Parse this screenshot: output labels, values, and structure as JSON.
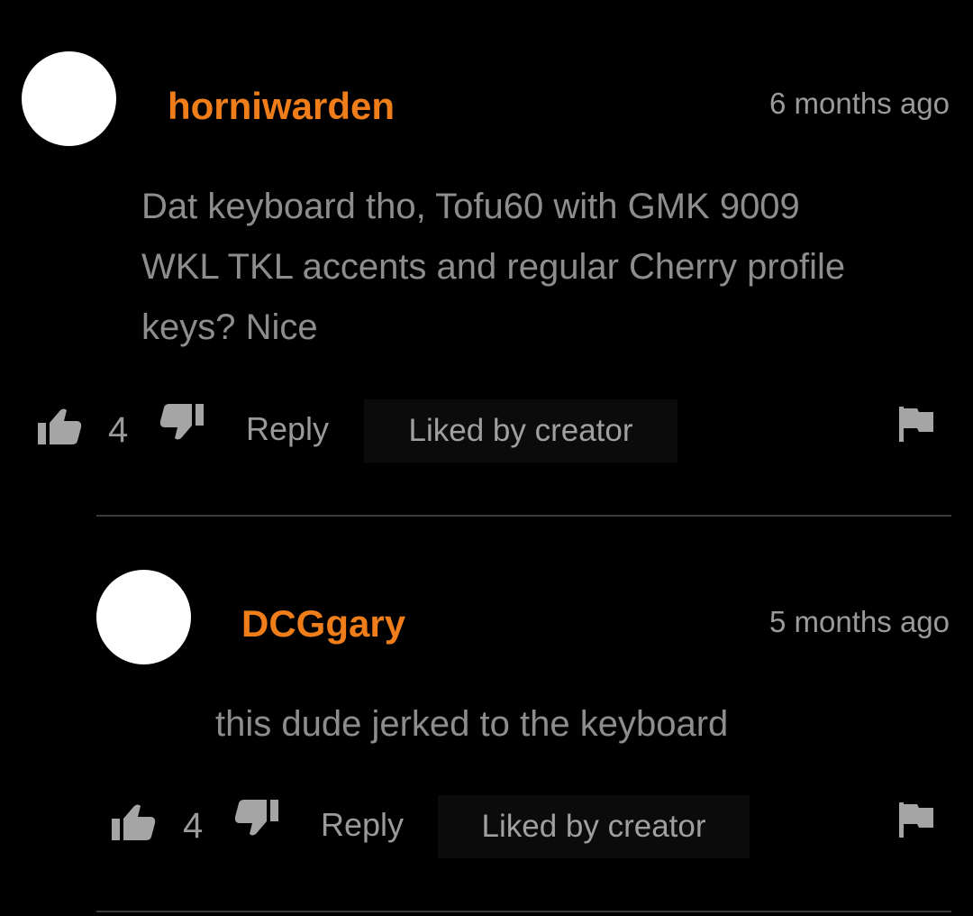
{
  "comments": [
    {
      "username": "horniwarden",
      "timestamp": "6 months ago",
      "lines": [
        "Dat keyboard tho, Tofu60 with GMK 9009",
        "WKL TKL accents and regular Cherry profile",
        "keys? Nice"
      ],
      "likes": "4",
      "reply_label": "Reply",
      "liked_label": "Liked by creator"
    },
    {
      "username": "DCGgary",
      "timestamp": "5 months ago",
      "lines": [
        "this dude jerked to the keyboard"
      ],
      "likes": "4",
      "reply_label": "Reply",
      "liked_label": "Liked by creator"
    }
  ],
  "icons": {
    "like": "thumbs-up-icon",
    "dislike": "thumbs-down-icon",
    "report": "flag-icon"
  },
  "colors": {
    "background": "#000000",
    "username": "#ee7d1a",
    "text": "#8d8d8d",
    "divider": "#3a3a3a"
  }
}
